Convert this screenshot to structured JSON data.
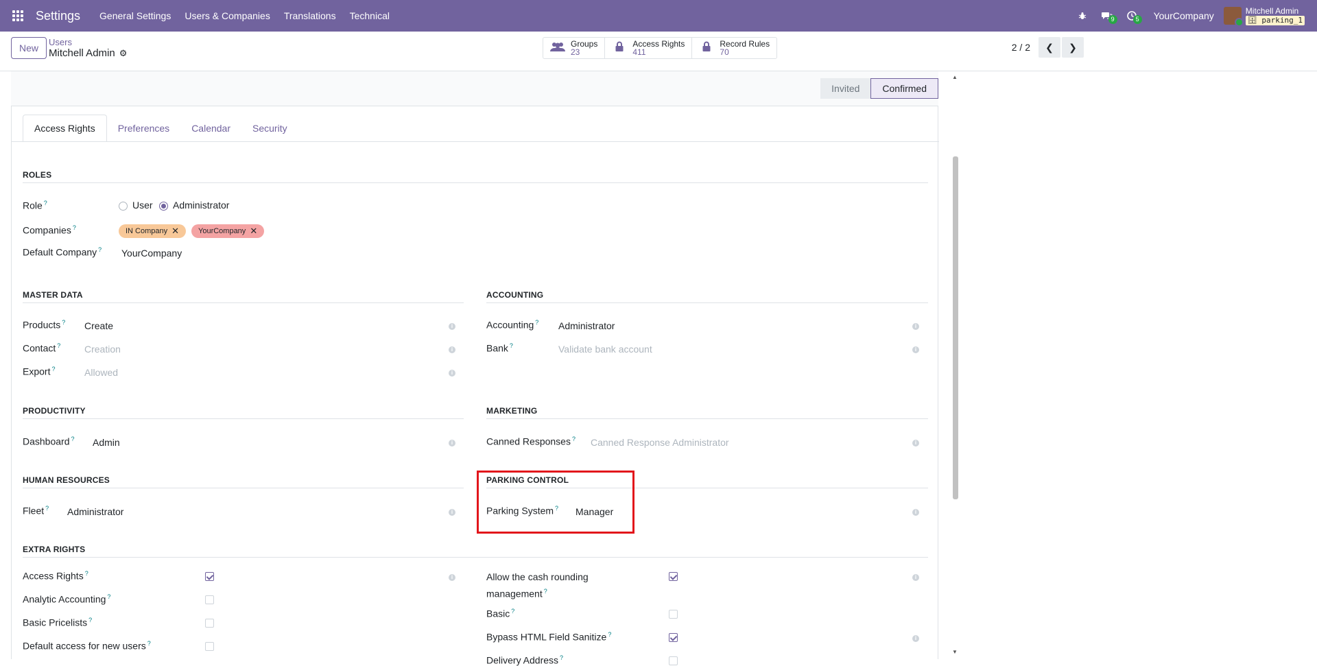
{
  "navbar": {
    "app_title": "Settings",
    "menu": [
      "General Settings",
      "Users & Companies",
      "Translations",
      "Technical"
    ],
    "debug_icon": "bug-icon",
    "messages_count": "9",
    "activities_count": "5",
    "company": "YourCompany",
    "user_name": "Mitchell Admin",
    "database": "parking_1",
    "colors": {
      "brand": "#71639e",
      "badge": "#28a745"
    }
  },
  "control_panel": {
    "new_label": "New",
    "breadcrumb_parent": "Users",
    "breadcrumb_current": "Mitchell Admin",
    "stats": [
      {
        "label": "Groups",
        "value": "23",
        "icon": "users-icon"
      },
      {
        "label": "Access Rights",
        "value": "411",
        "icon": "lock-icon"
      },
      {
        "label": "Record Rules",
        "value": "70",
        "icon": "lock-icon"
      }
    ],
    "pager": "2 / 2"
  },
  "statusbar": {
    "steps": [
      "Invited",
      "Confirmed"
    ],
    "active": "Confirmed"
  },
  "tabs": [
    "Access Rights",
    "Preferences",
    "Calendar",
    "Security"
  ],
  "active_tab": "Access Rights",
  "roles": {
    "title": "ROLES",
    "role_label": "Role",
    "role_options": [
      "User",
      "Administrator"
    ],
    "role_selected": "Administrator",
    "companies_label": "Companies",
    "companies": [
      {
        "name": "IN Company",
        "color": "#f8c898"
      },
      {
        "name": "YourCompany",
        "color": "#f4a3a3"
      }
    ],
    "default_company_label": "Default Company",
    "default_company": "YourCompany"
  },
  "sections": {
    "master_data": {
      "title": "MASTER DATA",
      "rows": [
        {
          "label": "Products",
          "value": "Create",
          "muted": false
        },
        {
          "label": "Contact",
          "value": "Creation",
          "muted": true
        },
        {
          "label": "Export",
          "value": "Allowed",
          "muted": true
        }
      ]
    },
    "accounting": {
      "title": "ACCOUNTING",
      "rows": [
        {
          "label": "Accounting",
          "value": "Administrator",
          "muted": false
        },
        {
          "label": "Bank",
          "value": "Validate bank account",
          "muted": true
        }
      ]
    },
    "productivity": {
      "title": "PRODUCTIVITY",
      "rows": [
        {
          "label": "Dashboard",
          "value": "Admin",
          "muted": false
        }
      ]
    },
    "marketing": {
      "title": "MARKETING",
      "rows": [
        {
          "label": "Canned Responses",
          "value": "Canned Response Administrator",
          "muted": true
        }
      ]
    },
    "human_resources": {
      "title": "HUMAN RESOURCES",
      "rows": [
        {
          "label": "Fleet",
          "value": "Administrator",
          "muted": false
        }
      ]
    },
    "parking_control": {
      "title": "PARKING CONTROL",
      "rows": [
        {
          "label": "Parking System",
          "value": "Manager",
          "muted": false
        }
      ]
    },
    "extra_rights": {
      "title": "EXTRA RIGHTS",
      "left": [
        {
          "label": "Access Rights",
          "checked": true
        },
        {
          "label": "Analytic Accounting",
          "checked": false
        },
        {
          "label": "Basic Pricelists",
          "checked": false
        },
        {
          "label": "Default access for new users",
          "checked": false
        }
      ],
      "right": [
        {
          "label": "Allow the cash rounding management",
          "checked": true
        },
        {
          "label": "Basic",
          "checked": false
        },
        {
          "label": "Bypass HTML Field Sanitize",
          "checked": true
        },
        {
          "label": "Delivery Address",
          "checked": false
        }
      ]
    }
  }
}
